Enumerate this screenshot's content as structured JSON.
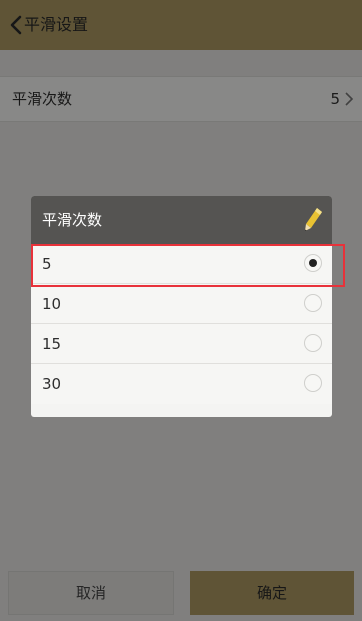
{
  "header": {
    "title": "平滑设置",
    "back_icon": "chevron-left-icon"
  },
  "setting": {
    "label": "平滑次数",
    "value": "5",
    "chevron_icon": "chevron-right-icon"
  },
  "buttons": {
    "cancel": "取消",
    "ok": "确定"
  },
  "dialog": {
    "title": "平滑次数",
    "edit_icon": "pencil-icon",
    "options": [
      {
        "label": "5",
        "selected": true
      },
      {
        "label": "10",
        "selected": false
      },
      {
        "label": "15",
        "selected": false
      },
      {
        "label": "30",
        "selected": false
      }
    ]
  },
  "colors": {
    "accent": "#ad9a63",
    "dialog_header": "#555452",
    "highlight": "#e8323a"
  }
}
